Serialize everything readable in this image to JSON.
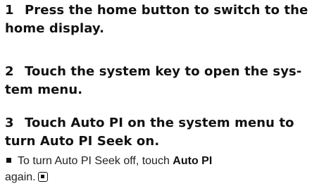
{
  "steps": [
    {
      "number": "1",
      "line1": "Press the home button to switch to the",
      "line2": "home display."
    },
    {
      "number": "2",
      "line1": "Touch the system key to open the sys-",
      "line2": "tem menu."
    },
    {
      "number": "3",
      "line1": "Touch Auto PI on the system menu to",
      "line2": "turn Auto PI Seek on."
    }
  ],
  "note": {
    "text_before": "To turn Auto PI Seek off, touch ",
    "bold_text": "Auto PI",
    "text_after": "again."
  },
  "icons": {
    "bullet": "square-bullet-icon",
    "end_mark": "end-of-section-icon"
  }
}
